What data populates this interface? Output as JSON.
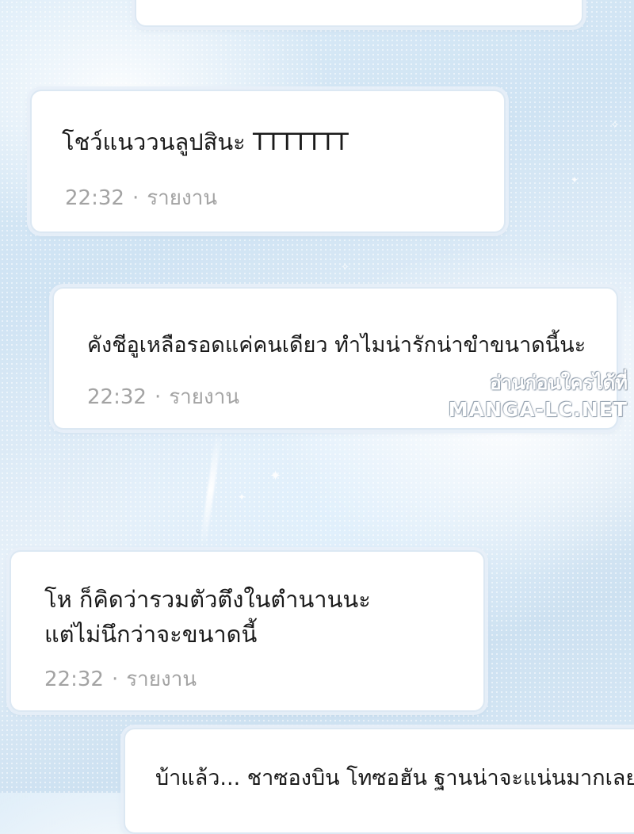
{
  "comments": [
    {
      "text": [
        ""
      ],
      "time": "",
      "report_label": ""
    },
    {
      "text": [
        "โชว์แนววนลูปสินะ TTTTTTT"
      ],
      "time": "22:32",
      "report_label": "รายงาน"
    },
    {
      "text": [
        "คังชีอูเหลือรอดแค่คนเดียว ทำไมน่ารักน่าขำขนาดนี้นะ"
      ],
      "time": "22:32",
      "report_label": "รายงาน"
    },
    {
      "text": [
        "โห ก็คิดว่ารวมตัวตึงในตำนานนะ",
        "แต่ไม่นึกว่าจะขนาดนี้"
      ],
      "time": "22:32",
      "report_label": "รายงาน"
    },
    {
      "text": [
        "บ้าแล้ว... ชาซองบิน โทซอฮัน ฐานน่าจะแน่นมากเลยนะ"
      ],
      "time": "",
      "report_label": ""
    }
  ],
  "separator": "·",
  "watermark": {
    "line1": "อ่านก่อนใครได้ที่",
    "line2": "MANGA-LC.NET"
  }
}
